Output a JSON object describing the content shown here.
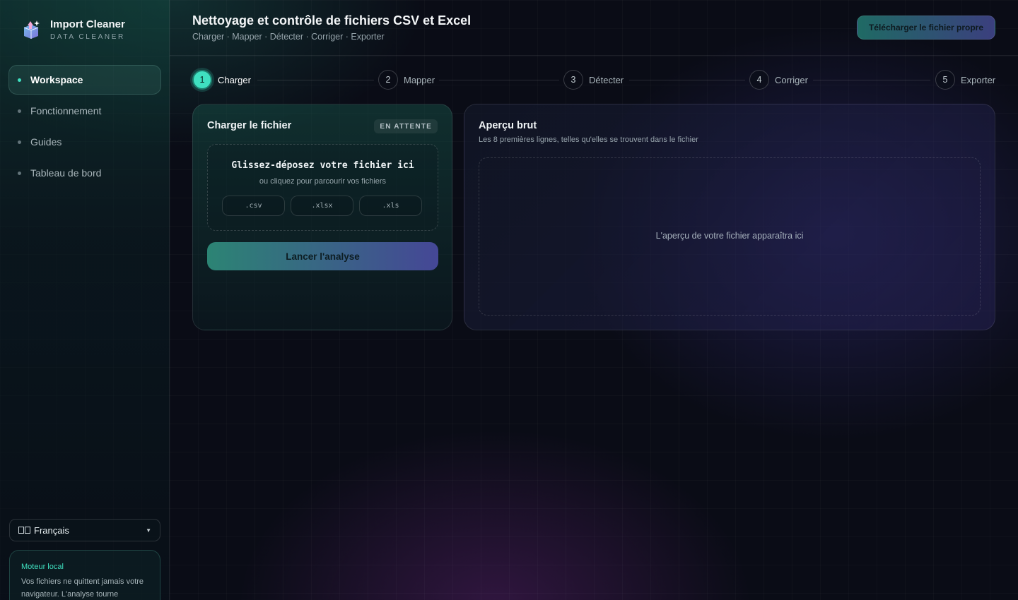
{
  "sidebar": {
    "brand_title": "Import Cleaner",
    "brand_subtitle": "DATA CLEANER",
    "items": [
      {
        "label": "Workspace",
        "active": true
      },
      {
        "label": "Fonctionnement",
        "active": false
      },
      {
        "label": "Guides",
        "active": false
      },
      {
        "label": "Tableau de bord",
        "active": false
      }
    ],
    "language": "Français",
    "engine_title": "Moteur local",
    "engine_text": "Vos fichiers ne quittent jamais votre navigateur. L'analyse tourne"
  },
  "header": {
    "title": "Nettoyage et contrôle de fichiers CSV et Excel",
    "subtitle": "Charger · Mapper · Détecter · Corriger · Exporter",
    "download_label": "Télécharger le fichier propre"
  },
  "steps": [
    {
      "num": "1",
      "label": "Charger",
      "active": true
    },
    {
      "num": "2",
      "label": "Mapper",
      "active": false
    },
    {
      "num": "3",
      "label": "Détecter",
      "active": false
    },
    {
      "num": "4",
      "label": "Corriger",
      "active": false
    },
    {
      "num": "5",
      "label": "Exporter",
      "active": false
    }
  ],
  "upload": {
    "title": "Charger le fichier",
    "status": "EN ATTENTE",
    "drop_title": "Glissez-déposez votre fichier ici",
    "drop_subtitle": "ou cliquez pour parcourir vos fichiers",
    "extensions": [
      ".csv",
      ".xlsx",
      ".xls"
    ],
    "run_label": "Lancer l'analyse"
  },
  "preview": {
    "title": "Aperçu brut",
    "subtitle": "Les 8 premières lignes, telles qu'elles se trouvent dans le fichier",
    "empty_text": "L'aperçu de votre fichier apparaîtra ici"
  },
  "colors": {
    "accent": "#3fe0c0",
    "background": "#0a0c16"
  }
}
